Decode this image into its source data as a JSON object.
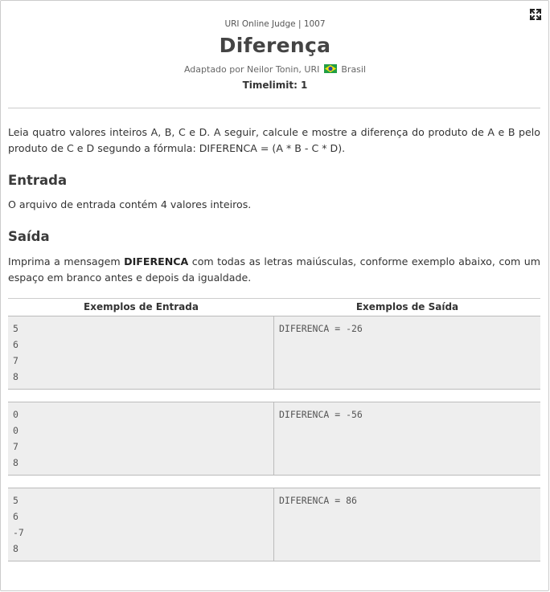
{
  "header": {
    "judge": "URI Online Judge | 1007",
    "title": "Diferença",
    "author_prefix": "Adaptado por Neilor Tonin, URI",
    "author_country": "Brasil",
    "timelimit": "Timelimit: 1"
  },
  "description": {
    "text": "Leia quatro valores inteiros A, B, C e D. A seguir, calcule e mostre a diferença do produto de A e B pelo produto de C e D segundo a fórmula: DIFERENCA = (A * B - C * D)."
  },
  "input_section": {
    "heading": "Entrada",
    "text": "O arquivo de entrada contém 4 valores inteiros."
  },
  "output_section": {
    "heading": "Saída",
    "text_before": "Imprima a mensagem ",
    "text_bold": "DIFERENCA",
    "text_after": " com todas as letras maiúsculas, conforme exemplo abaixo, com um espaço em branco antes e depois da igualdade."
  },
  "samples": {
    "input_header": "Exemplos de Entrada",
    "output_header": "Exemplos de Saída",
    "cases": [
      {
        "input": [
          "5",
          "6",
          "7",
          "8"
        ],
        "output": "DIFERENCA = -26"
      },
      {
        "input": [
          "0",
          "0",
          "7",
          "8"
        ],
        "output": "DIFERENCA = -56"
      },
      {
        "input": [
          "5",
          "6",
          "-7",
          "8"
        ],
        "output": "DIFERENCA = 86"
      }
    ]
  },
  "icons": {
    "fullscreen": "expand-icon",
    "flag": "brazil-flag-icon"
  },
  "colors": {
    "sample_background": "#eeeeee",
    "rule": "#cccccc",
    "flag_green": "#229e45",
    "flag_yellow": "#f8e509",
    "flag_blue": "#2b49a3"
  }
}
